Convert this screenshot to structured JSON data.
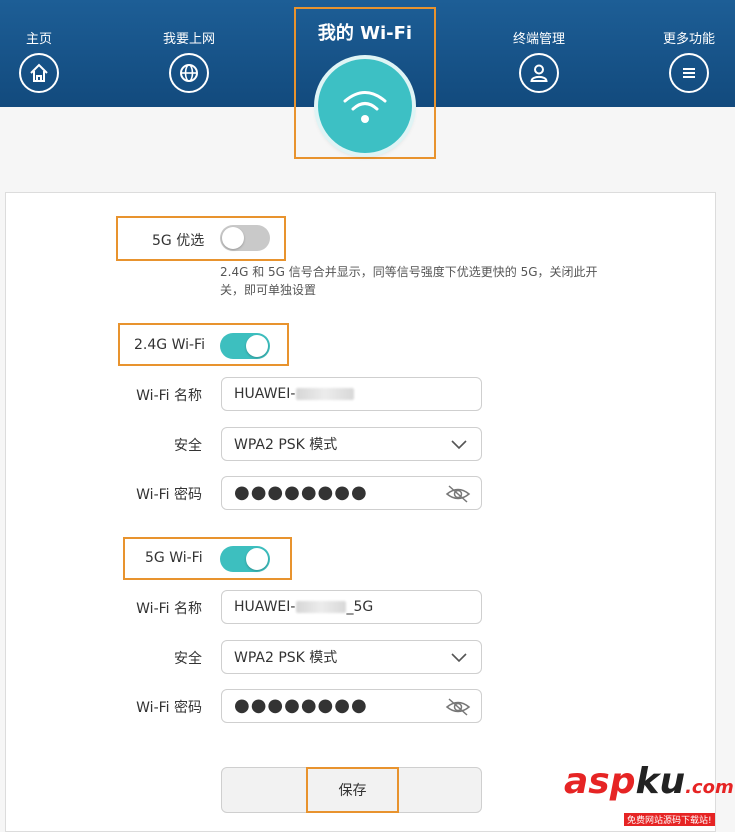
{
  "nav": {
    "items": [
      {
        "label": "主页",
        "icon": "home-icon"
      },
      {
        "label": "我要上网",
        "icon": "globe-icon"
      },
      {
        "label": "终端管理",
        "icon": "user-icon"
      },
      {
        "label": "更多功能",
        "icon": "menu-icon"
      }
    ],
    "active": {
      "label": "我的 Wi-Fi",
      "icon": "wifi-icon"
    }
  },
  "pref5g": {
    "label": "5G 优选",
    "enabled": false,
    "hint": "2.4G 和 5G 信号合并显示，同等信号强度下优选更快的 5G，关闭此开关，即可单独设置"
  },
  "wifi24": {
    "label": "2.4G Wi-Fi",
    "enabled": true,
    "name_label": "Wi-Fi 名称",
    "name_prefix": "HUAWEI-",
    "name_suffix": "",
    "security_label": "安全",
    "security_value": "WPA2 PSK 模式",
    "password_label": "Wi-Fi 密码",
    "password_mask": "●●●●●●●●"
  },
  "wifi5": {
    "label": "5G Wi-Fi",
    "enabled": true,
    "name_label": "Wi-Fi 名称",
    "name_prefix": "HUAWEI-",
    "name_suffix": "_5G",
    "security_label": "安全",
    "security_value": "WPA2 PSK 模式",
    "password_label": "Wi-Fi 密码",
    "password_mask": "●●●●●●●●"
  },
  "save_label": "保存",
  "watermark": {
    "main_a": "asp",
    "main_b": "ku",
    "main_c": ".com",
    "sub": "免费网站源码下载站!"
  },
  "colors": {
    "header": "#1a5a92",
    "accent": "#3dbfbf",
    "highlight": "#e8932e"
  }
}
